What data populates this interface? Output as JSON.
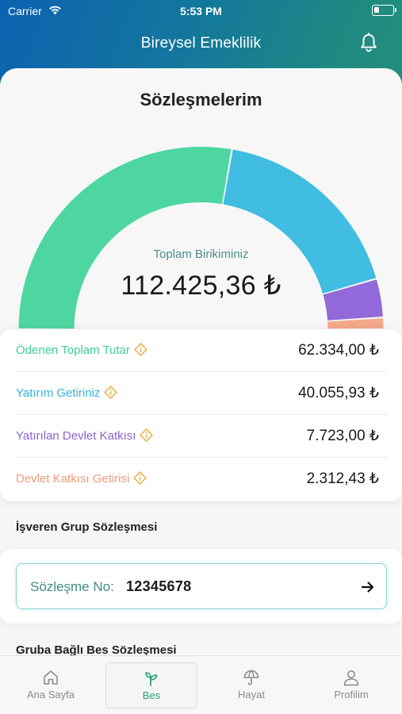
{
  "status_bar": {
    "carrier": "Carrier",
    "time": "5:53 PM",
    "battery_level": 0.25
  },
  "nav": {
    "title": "Bireysel Emeklilik",
    "bell_icon": "bell-icon"
  },
  "summary": {
    "title": "Sözleşmelerim",
    "total_label": "Toplam Birikiminiz",
    "total_value": "112.425,36 ₺"
  },
  "gauge": {
    "segments": [
      {
        "key": "paid",
        "value": 62334.0,
        "color": "#4dd6a1"
      },
      {
        "key": "return",
        "value": 40055.93,
        "color": "#40bde0"
      },
      {
        "key": "state",
        "value": 7723.0,
        "color": "#9169d8"
      },
      {
        "key": "state_return",
        "value": 2312.43,
        "color": "#f5a88a"
      }
    ]
  },
  "breakdown": {
    "rows": [
      {
        "label": "Ödenen Toplam Tutar",
        "value": "62.334,00 ₺",
        "color": "#3fcf97"
      },
      {
        "label": "Yatırım Getiriniz",
        "value": "40.055,93 ₺",
        "color": "#32b4dc"
      },
      {
        "label": "Yatırılan Devlet Katkısı",
        "value": "7.723,00 ₺",
        "color": "#8c62d0"
      },
      {
        "label": "Devlet Katkısı Getirisi",
        "value": "2.312,43 ₺",
        "color": "#f09a7a"
      }
    ],
    "info_icon": "info-icon",
    "info_color": "#e5a935"
  },
  "employer": {
    "section_title": "İşveren Grup Sözleşmesi",
    "contract_label": "Sözleşme No:",
    "contract_no": "12345678",
    "arrow_icon": "arrow-right-icon"
  },
  "group": {
    "section_title": "Gruba Bağlı Bes Sözleşmesi"
  },
  "tabbar": {
    "items": [
      {
        "label": "Ana Sayfa",
        "icon": "home-icon"
      },
      {
        "label": "Bes",
        "icon": "sprout-icon",
        "active": true
      },
      {
        "label": "Hayat",
        "icon": "umbrella-icon"
      },
      {
        "label": "Profilim",
        "icon": "user-icon"
      }
    ]
  }
}
